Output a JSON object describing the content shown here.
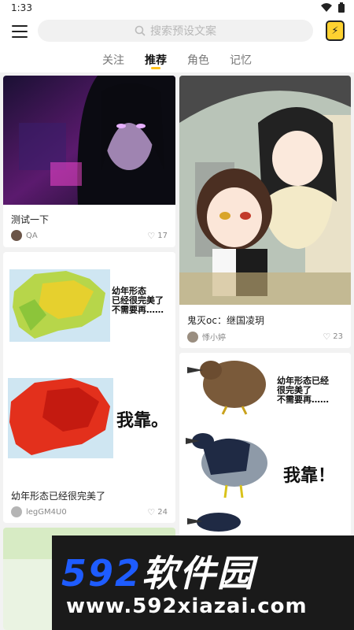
{
  "status_bar": {
    "time": "1:33"
  },
  "header": {
    "search_placeholder": "搜索预设文案",
    "app_icon_glyph": "⚡"
  },
  "tabs": [
    {
      "label": "关注",
      "active": false
    },
    {
      "label": "推荐",
      "active": true
    },
    {
      "label": "角色",
      "active": false
    },
    {
      "label": "记忆",
      "active": false
    }
  ],
  "cards": [
    {
      "title": "测试一下",
      "author": "QA",
      "likes": "17"
    },
    {
      "title": "鬼灭oc：继国凌玥",
      "author": "悸小婷",
      "likes": "23"
    },
    {
      "title": "幼年形态已经很完美了",
      "author": "legGM4U0",
      "likes": "24",
      "meme_caption": "幼年形态\n已经很完美了\n不需要再……",
      "meme_big": "我靠。"
    },
    {
      "meme_caption": "幼年形态已经\n很完美了\n不需要再……",
      "meme_big": "我靠！"
    }
  ],
  "watermark": {
    "brand_num": "592",
    "brand_text": "软件园",
    "url": "www.592xiazai.com"
  }
}
